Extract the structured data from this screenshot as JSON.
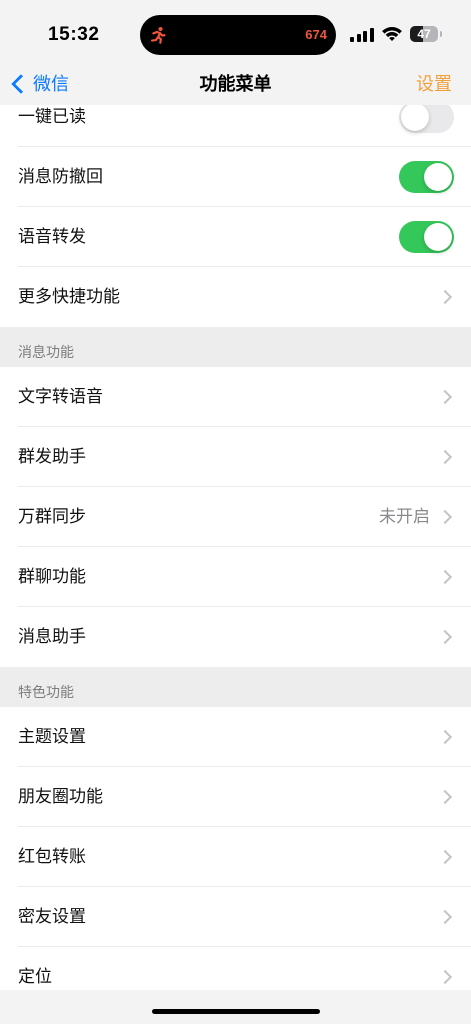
{
  "status_bar": {
    "time": "15:32",
    "activity_value": "674",
    "battery_level": "47",
    "activity_icon": "running-figure-icon",
    "signal_icon": "cellular-signal-icon",
    "wifi_icon": "wifi-icon",
    "battery_icon": "battery-icon"
  },
  "nav": {
    "back_icon": "chevron-left-icon",
    "back_label": "微信",
    "title": "功能菜单",
    "action_label": "设置"
  },
  "colors": {
    "accent_blue": "#0a7aff",
    "accent_orange": "#f2a03d",
    "toggle_on": "#34c759",
    "toggle_off": "#e9e9eb",
    "activity_red": "#f2553b",
    "secondary_text": "#8a8a8e",
    "chevron_gray": "#c4c4c7"
  },
  "sections": [
    {
      "items": [
        {
          "label": "一键已读",
          "toggle_on": false
        },
        {
          "label": "消息防撤回",
          "toggle_on": true
        },
        {
          "label": "语音转发",
          "toggle_on": true
        },
        {
          "label": "更多快捷功能",
          "icon": "chevron-right-icon"
        }
      ]
    },
    {
      "header": "消息功能",
      "items": [
        {
          "label": "文字转语音",
          "icon": "chevron-right-icon"
        },
        {
          "label": "群发助手",
          "icon": "chevron-right-icon"
        },
        {
          "label": "万群同步",
          "value": "未开启",
          "icon": "chevron-right-icon"
        },
        {
          "label": "群聊功能",
          "icon": "chevron-right-icon"
        },
        {
          "label": "消息助手",
          "icon": "chevron-right-icon"
        }
      ]
    },
    {
      "header": "特色功能",
      "items": [
        {
          "label": "主题设置",
          "icon": "chevron-right-icon"
        },
        {
          "label": "朋友圈功能",
          "icon": "chevron-right-icon"
        },
        {
          "label": "红包转账",
          "icon": "chevron-right-icon"
        },
        {
          "label": "密友设置",
          "icon": "chevron-right-icon"
        },
        {
          "label": "定位",
          "icon": "chevron-right-icon"
        }
      ]
    }
  ]
}
